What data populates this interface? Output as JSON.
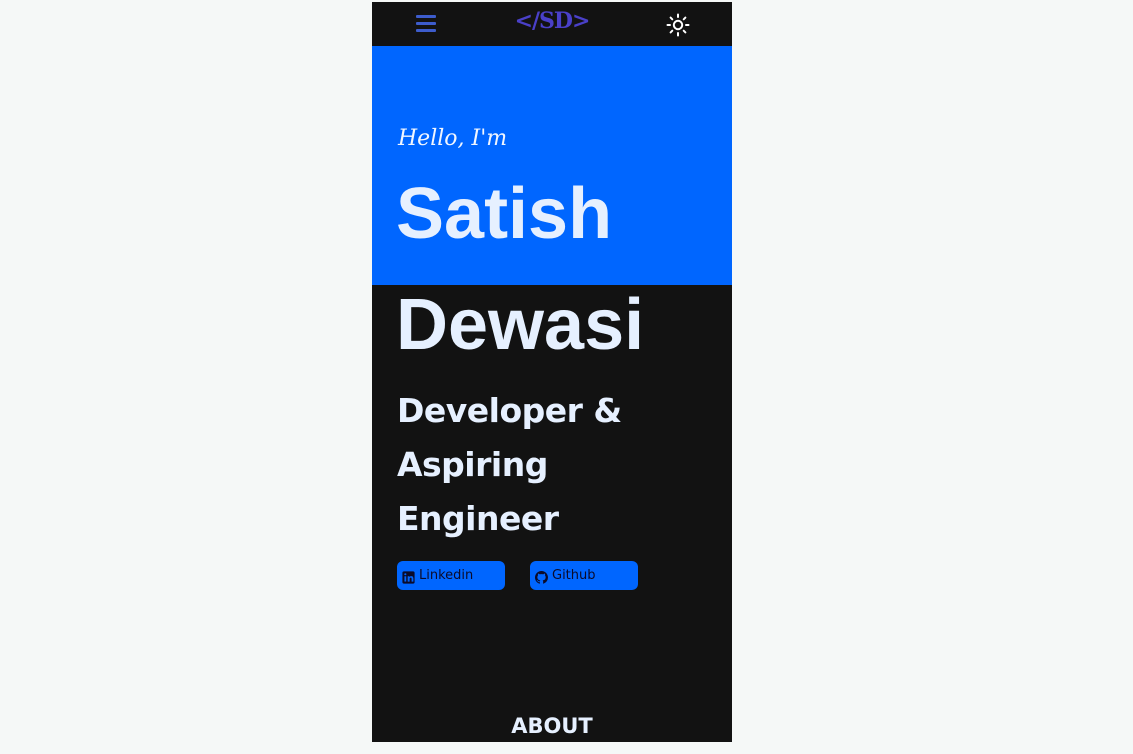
{
  "navbar": {
    "menu_icon": "hamburger-menu-icon",
    "logo_text": "</SD>",
    "theme_icon": "sun-icon"
  },
  "hero": {
    "greeting": "Hello, I'm",
    "first_name": "Satish",
    "last_name": "Dewasi",
    "tagline_lines": [
      "Developer &",
      "Aspiring",
      "Engineer"
    ]
  },
  "social": {
    "linkedin_label": "Linkedin",
    "linkedin_icon": "linkedin-icon",
    "github_label": "Github",
    "github_icon": "github-icon"
  },
  "sections": {
    "about_heading": "ABOUT"
  },
  "colors": {
    "page_background": "#f5f8f7",
    "app_background": "#121212",
    "accent_blue": "#0066ff",
    "logo_color": "#4a40c8",
    "text_light": "#e6f0ff"
  }
}
